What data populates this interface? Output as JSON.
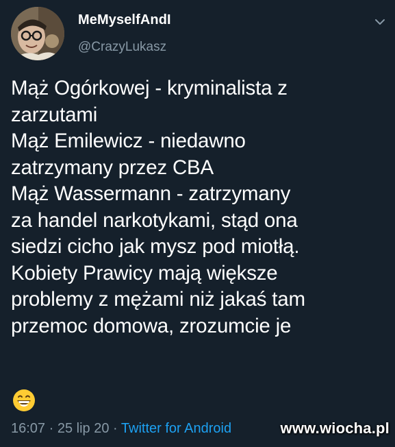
{
  "author": {
    "display_name": "MeMyselfAndI",
    "handle": "@CrazyLukasz",
    "avatar_icon": "avatar-photo"
  },
  "tweet": {
    "lines": [
      "Mąż Ogórkowej - kryminalista z",
      "zarzutami",
      "Mąż Emilewicz - niedawno",
      "zatrzymany przez CBA",
      "Mąż Wassermann - zatrzymany",
      "za handel narkotykami, stąd ona",
      "siedzi cicho jak mysz pod miotłą.",
      "Kobiety Prawicy mają większe",
      "problemy z mężami niż jakaś tam",
      "przemoc domowa, zrozumcie je"
    ],
    "emoji_icon": "grinning-face-icon",
    "time": "16:07",
    "separator1": " · ",
    "date": "25 lip 20",
    "separator2": " · ",
    "source": "Twitter for Android"
  },
  "menu_icon": "chevron-down-icon",
  "watermark": "www.wiocha.pl",
  "colors": {
    "background": "#15202b",
    "text": "#ffffff",
    "secondary": "#8899a6",
    "link": "#1da1f2"
  }
}
